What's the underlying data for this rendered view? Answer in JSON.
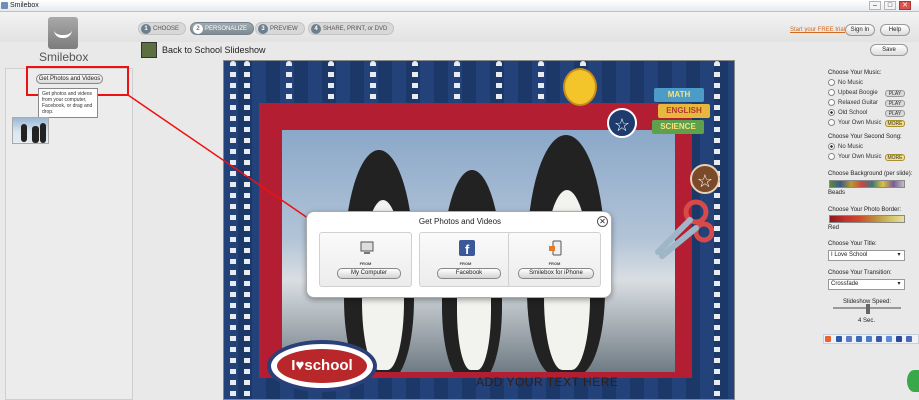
{
  "window": {
    "title": "Smilebox",
    "btn_min": "–",
    "btn_max": "□",
    "btn_close": "✕"
  },
  "logo": {
    "text": "Smilebox"
  },
  "steps": [
    {
      "num": "1",
      "label": "CHOOSE"
    },
    {
      "num": "2",
      "label": "PERSONALIZE"
    },
    {
      "num": "3",
      "label": "PREVIEW"
    },
    {
      "num": "4",
      "label": "SHARE, PRINT, or DVD"
    }
  ],
  "header": {
    "trial_link": "Start your FREE trial",
    "sign_in": "Sign In",
    "help": "Help"
  },
  "page": {
    "title": "Back to School Slideshow",
    "save": "Save"
  },
  "left": {
    "get_photos": "Get Photos and Videos",
    "tooltip": "Get photos and videos from your computer, Facebook, or drag and drop."
  },
  "stage": {
    "badge_left": "I",
    "badge_heart": "♥",
    "badge_right": "school",
    "add_text": "ADD YOUR TEXT HERE",
    "books": [
      "MATH",
      "ENGLISH",
      "SCIENCE"
    ]
  },
  "modal": {
    "title": "Get Photos and Videos",
    "close": "✕",
    "sources": [
      {
        "from": "FROM",
        "button": "My Computer"
      },
      {
        "from": "FROM",
        "button": "Facebook"
      },
      {
        "from": "FROM",
        "button": "Smilebox for iPhone"
      }
    ]
  },
  "right": {
    "music_label": "Choose Your Music:",
    "music": [
      {
        "label": "No Music",
        "selected": false,
        "tag": ""
      },
      {
        "label": "Upbeat Boogie",
        "selected": false,
        "tag": "PLAY"
      },
      {
        "label": "Relaxed Guitar",
        "selected": false,
        "tag": "PLAY"
      },
      {
        "label": "Old School",
        "selected": true,
        "tag": "PLAY"
      },
      {
        "label": "Your Own Music",
        "selected": false,
        "tag": "MORE"
      }
    ],
    "second_label": "Choose Your Second Song:",
    "second": [
      {
        "label": "No Music",
        "selected": true,
        "tag": ""
      },
      {
        "label": "Your Own Music",
        "selected": false,
        "tag": "MORE"
      }
    ],
    "background_label": "Choose Background (per slide):",
    "background_value": "Beads",
    "border_label": "Choose Your Photo Border:",
    "border_value": "Red",
    "title_label": "Choose Your Title:",
    "title_value": "I Love School",
    "transition_label": "Choose Your Transition:",
    "transition_value": "Crossfade",
    "speed_label": "Slideshow Speed:",
    "speed_value": "4 Sec."
  },
  "colors": {
    "accent_red": "#e11111",
    "stage_blue": "#24427a",
    "frame_red": "#b31e32"
  }
}
